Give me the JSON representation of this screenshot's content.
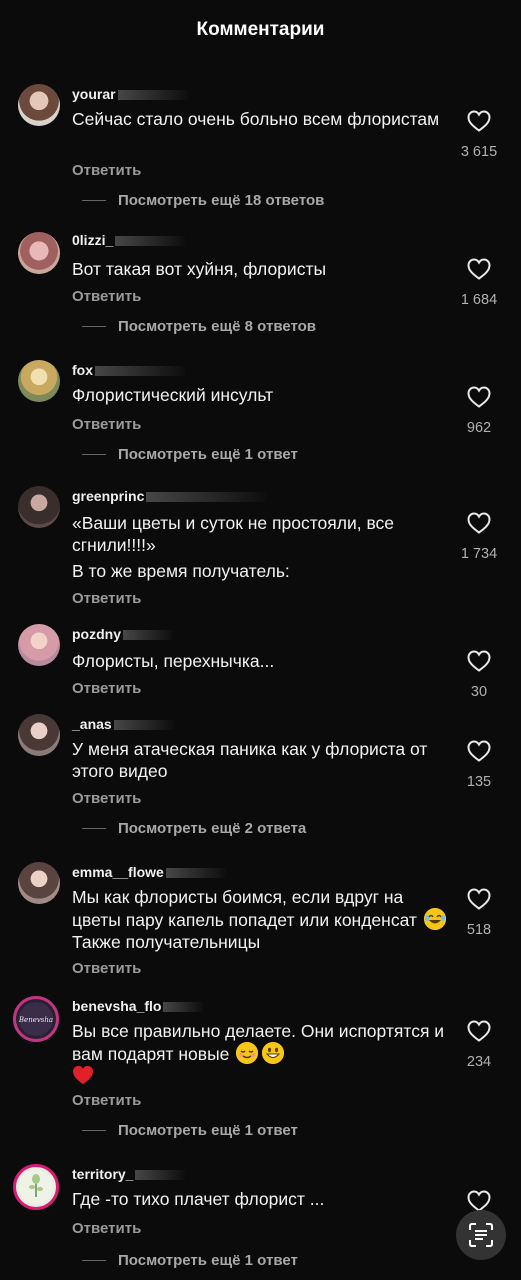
{
  "header": {
    "title": "Комментарии"
  },
  "labels": {
    "reply": "Ответить"
  },
  "comments": [
    {
      "username": "yourar",
      "text": "Сейчас стало очень больно всем флористам",
      "likes": "3 615",
      "thread": "Посмотреть ещё 18 ответов",
      "avatar_color": "#8a6a5a"
    },
    {
      "username": "0lizzi_",
      "text": "Вот такая вот ху​йня, флористы",
      "likes": "1 684",
      "thread": "Посмотреть ещё 8 ответов",
      "avatar_color": "#b07a7a"
    },
    {
      "username": "fox",
      "text": "Флористический инсульт",
      "likes": "962",
      "thread": "Посмотреть ещё 1 ответ",
      "avatar_color": "#c9b27a"
    },
    {
      "username": "greenprinc",
      "text": "«Ваши цветы и суток не простояли, все сгнили!!!!»",
      "text2": "В то же время получатель:",
      "likes": "1 734",
      "thread": "",
      "avatar_color": "#5a4a48"
    },
    {
      "username": "pozdny",
      "text": "Флористы, перехнычка...",
      "likes": "30",
      "thread": "",
      "avatar_color": "#d6a3a8"
    },
    {
      "username": "_anas",
      "text": "У меня атаческая паника как у флориста от этого видео",
      "likes": "135",
      "thread": "Посмотреть ещё 2 ответа",
      "avatar_color": "#6a5552"
    },
    {
      "username": "emma__flowe",
      "text": "Мы как флористы боимся, если вдруг на цветы пару капель попадет или конденсат",
      "text_after_emoji": "Также получательницы",
      "likes": "518",
      "thread": "",
      "avatar_color": "#7a6560"
    },
    {
      "username": "benevsha_flo",
      "text": "Вы все правильно делаете. Они испортятся и вам подарят новые",
      "likes": "234",
      "thread": "Посмотреть ещё 1 ответ",
      "avatar_color": "#4a3b5a",
      "avatar_text": "Benevsha"
    },
    {
      "username": "territory_",
      "text": "Где -то тихо плачет флорист ...",
      "likes": "",
      "thread": "Посмотреть ещё 1 ответ",
      "avatar_color": "#e8efe0"
    }
  ],
  "icons": {
    "like": "heart-outline-icon",
    "scan": "scan-text-icon"
  },
  "colors": {
    "background": "#0b0b0b",
    "muted": "#9a9a9a",
    "ring": "#c13584"
  }
}
